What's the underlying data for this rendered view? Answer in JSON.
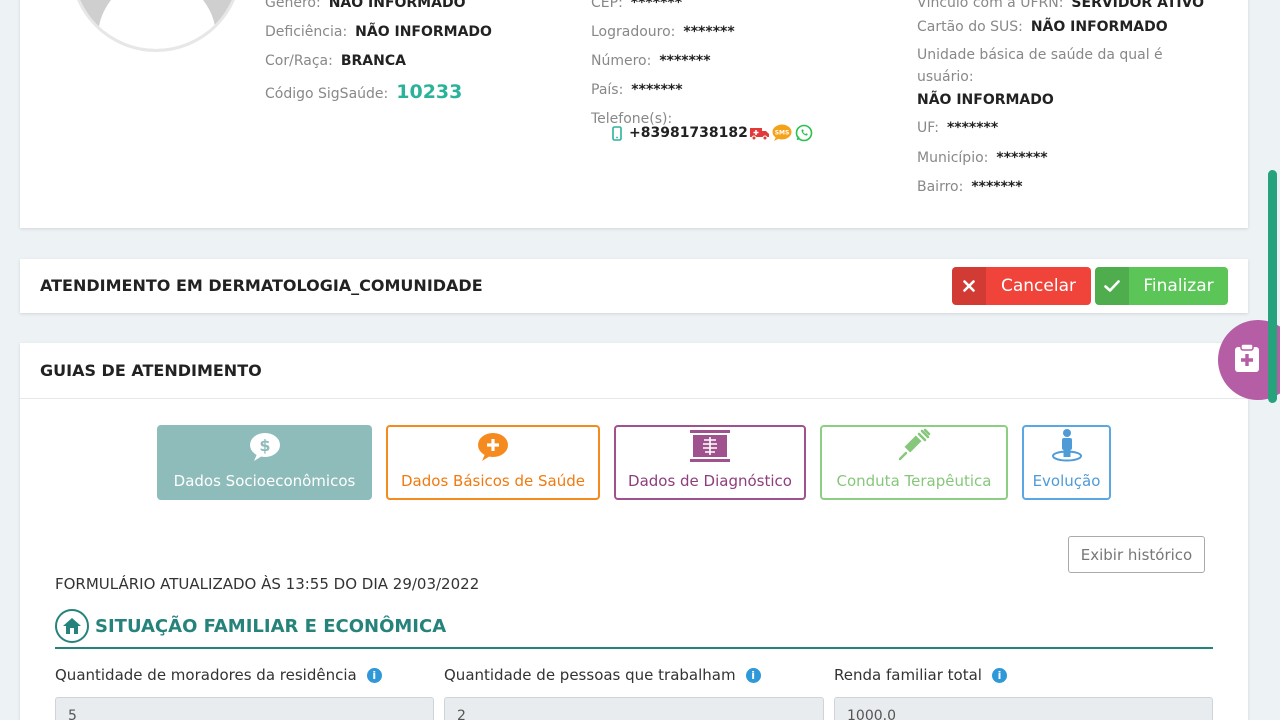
{
  "patient": {
    "col1": {
      "genero_label": "Gênero:",
      "genero_value": "NÃO INFORMADO",
      "deficiencia_label": "Deficiência:",
      "deficiencia_value": "NÃO INFORMADO",
      "cor_label": "Cor/Raça:",
      "cor_value": "BRANCA",
      "codigo_label": "Código SigSaúde:",
      "codigo_value": "10233"
    },
    "col2": {
      "cep_label": "CEP:",
      "cep_value": "*******",
      "logradouro_label": "Logradouro:",
      "logradouro_value": "*******",
      "numero_label": "Número:",
      "numero_value": "*******",
      "pais_label": "País:",
      "pais_value": "*******",
      "telefone_label": "Telefone(s):",
      "telefone_value": "+83981738182"
    },
    "col3": {
      "vinculo_label": "Vínculo com a UFRN:",
      "vinculo_value": "SERVIDOR ATIVO",
      "sus_label": "Cartão do SUS:",
      "sus_value": "NÃO INFORMADO",
      "unidade_label": "Unidade básica de saúde da qual é usuário:",
      "unidade_value": "NÃO INFORMADO",
      "uf_label": "UF:",
      "uf_value": "*******",
      "municipio_label": "Município:",
      "municipio_value": "*******",
      "bairro_label": "Bairro:",
      "bairro_value": "*******"
    }
  },
  "attendance": {
    "title": "ATENDIMENTO EM DERMATOLOGIA_COMUNIDADE",
    "cancel_label": "Cancelar",
    "finish_label": "Finalizar"
  },
  "guides": {
    "title": "GUIAS DE ATENDIMENTO",
    "tabs": [
      {
        "label": "Dados Socioeconômicos"
      },
      {
        "label": "Dados Básicos de Saúde"
      },
      {
        "label": "Dados de Diagnóstico"
      },
      {
        "label": "Conduta Terapêutica"
      },
      {
        "label": "Evolução"
      }
    ],
    "history_label": "Exibir histórico",
    "form_updated": "FORMULÁRIO ATUALIZADO ÀS 13:55 DO DIA 29/03/2022",
    "section_title": "SITUAÇÃO FAMILIAR E ECONÔMICA",
    "fields": [
      {
        "label": "Quantidade de moradores da residência",
        "value": "5"
      },
      {
        "label": "Quantidade de pessoas que trabalham",
        "value": "2"
      },
      {
        "label": "Renda familiar total",
        "value": "1000.0"
      }
    ]
  },
  "colors": {
    "teal": "#26837c",
    "cancel": "#f0443b",
    "finish": "#5cc558",
    "float": "#b55da5"
  }
}
